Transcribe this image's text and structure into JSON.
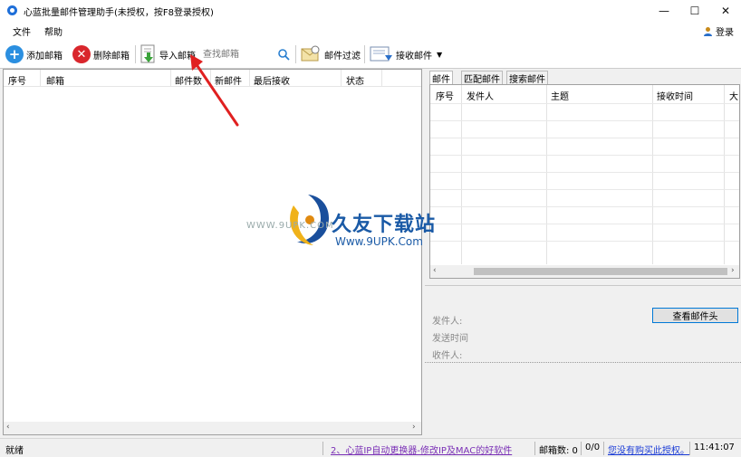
{
  "window": {
    "title": "心蓝批量邮件管理助手(未授权，按F8登录授权)",
    "minimize": "—",
    "maximize": "☐",
    "close": "✕"
  },
  "menu": {
    "items": [
      "文件",
      "帮助"
    ],
    "login": "登录"
  },
  "toolbar": {
    "add_mailbox": "添加邮箱",
    "delete_mailbox": "删除邮箱",
    "import_mailbox": "导入邮箱",
    "search_placeholder": "查找邮箱",
    "mail_filter": "邮件过滤",
    "receive_mail": "接收邮件"
  },
  "left_table": {
    "columns": [
      "序号",
      "邮箱",
      "邮件数",
      "新邮件",
      "最后接收",
      "状态"
    ]
  },
  "right_tabs": [
    "邮件",
    "匹配邮件",
    "搜索邮件"
  ],
  "right_table": {
    "columns": [
      "序号",
      "发件人",
      "主题",
      "接收时间",
      "大"
    ]
  },
  "detail": {
    "view_header_button": "查看邮件头",
    "sender_label": "发件人:",
    "send_time_label": "发送时间",
    "recipient_label": "收件人:"
  },
  "watermark": {
    "brand": "久友下载站",
    "url": "Www.9UPK.Com",
    "small": "WWW.9UPK.COM"
  },
  "status": {
    "ready": "就绪",
    "ad_link": "2、心蓝IP自动更换器-修改IP及MAC的好软件",
    "mail_count": "邮箱数: 0",
    "ratio": "0/0",
    "license": "您没有购买此授权。",
    "time": "11:41:07"
  },
  "colors": {
    "accent": "#0078d7",
    "brand": "#1a5aa6",
    "link": "#1a3bd6",
    "arrow": "#e02020"
  }
}
